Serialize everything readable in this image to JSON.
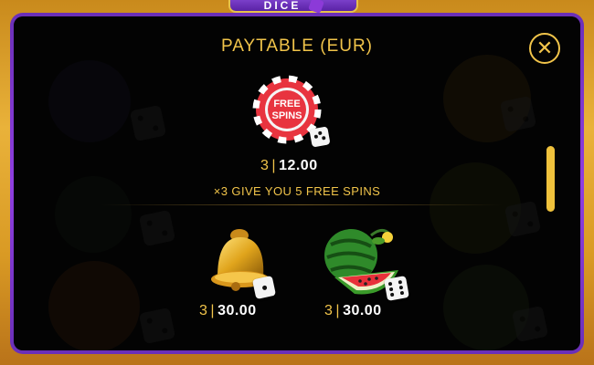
{
  "logo": {
    "text": "DICE"
  },
  "paytable": {
    "title": "PAYTABLE  (EUR)",
    "close_icon": "close-icon",
    "entries": [
      {
        "symbol": "free-spins-chip",
        "chip_text_line1": "FREE",
        "chip_text_line2": "SPINS",
        "count": "3",
        "separator": "|",
        "payout": "12.00",
        "note": "×3 GIVE YOU 5 FREE SPINS"
      },
      {
        "symbol": "golden-bell",
        "count": "3",
        "separator": "|",
        "payout": "30.00"
      },
      {
        "symbol": "watermelon",
        "count": "3",
        "separator": "|",
        "payout": "30.00"
      }
    ]
  },
  "colors": {
    "accent_gold": "#f1c44a",
    "frame_purple": "#8e3ee0",
    "chip_red": "#e8343f",
    "panel_bg": "#080808"
  }
}
